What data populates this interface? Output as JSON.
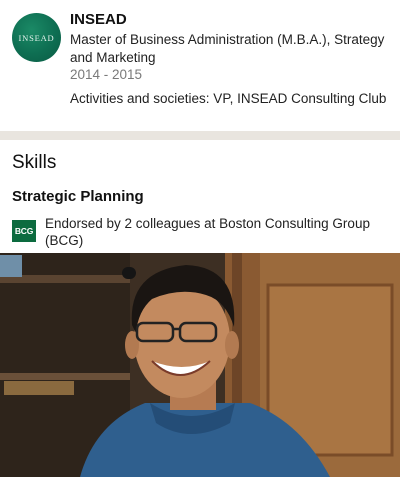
{
  "education": {
    "logo_text": "INSEAD",
    "school": "INSEAD",
    "degree": "Master of Business Administration (M.B.A.), Strategy and Marketing",
    "years": "2014 - 2015",
    "activities": "Activities and societies: VP, INSEAD Consulting Club"
  },
  "skills": {
    "title": "Skills",
    "items": [
      {
        "name": "Strategic Planning",
        "endorse_logo_text": "BCG",
        "endorsement": "Endorsed by 2 colleagues at Boston Consulting Group (BCG)"
      }
    ]
  },
  "colors": {
    "school_logo_green": "#0e6e52",
    "bcg_green": "#0c6b3f",
    "divider": "#e9e5df",
    "muted_text": "#7a7a7a"
  }
}
